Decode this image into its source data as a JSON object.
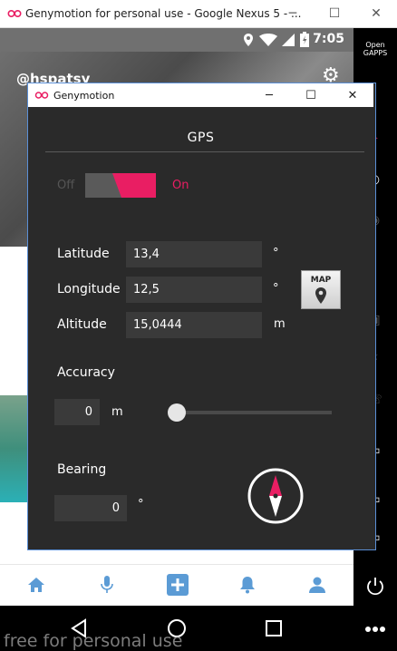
{
  "outer_window": {
    "title": "Genymotion for personal use - Google Nexus 5 - ...",
    "controls": {
      "minimize": "─",
      "maximize": "☐",
      "close": "✕"
    }
  },
  "android": {
    "status_time": "7:05",
    "username": "@hspatsy",
    "watermark": "free for personal use"
  },
  "right_toolbar": {
    "opengapps_label": "Open GAPPS"
  },
  "dialog": {
    "title": "Genymotion",
    "controls": {
      "minimize": "─",
      "maximize": "☐",
      "close": "✕"
    },
    "section_title": "GPS",
    "toggle": {
      "off_label": "Off",
      "on_label": "On",
      "state": "on"
    },
    "latitude": {
      "label": "Latitude",
      "value": "13,4",
      "unit": "°"
    },
    "longitude": {
      "label": "Longitude",
      "value": "12,5",
      "unit": "°"
    },
    "altitude": {
      "label": "Altitude",
      "value": "15,0444",
      "unit": "m"
    },
    "map_button_label": "MAP",
    "accuracy": {
      "label": "Accuracy",
      "value": "0",
      "unit": "m",
      "slider_level": 0
    },
    "bearing": {
      "label": "Bearing",
      "value": "0",
      "unit": "°"
    }
  },
  "colors": {
    "accent": "#e91e63",
    "dialog_bg": "#2a2a2a",
    "input_bg": "#3a3a3a",
    "nav_icon": "#5b9bd5",
    "dialog_border": "#5b8fd6"
  },
  "icons": [
    "genymotion-logo-icon",
    "location-icon",
    "wifi-icon",
    "signal-icon",
    "battery-icon",
    "settings-gear-icon",
    "home-icon",
    "microphone-icon",
    "add-icon",
    "bell-icon",
    "profile-icon",
    "back-icon",
    "home-circle-icon",
    "recents-icon",
    "more-icon",
    "map-pin-icon",
    "compass-icon",
    "power-icon"
  ]
}
